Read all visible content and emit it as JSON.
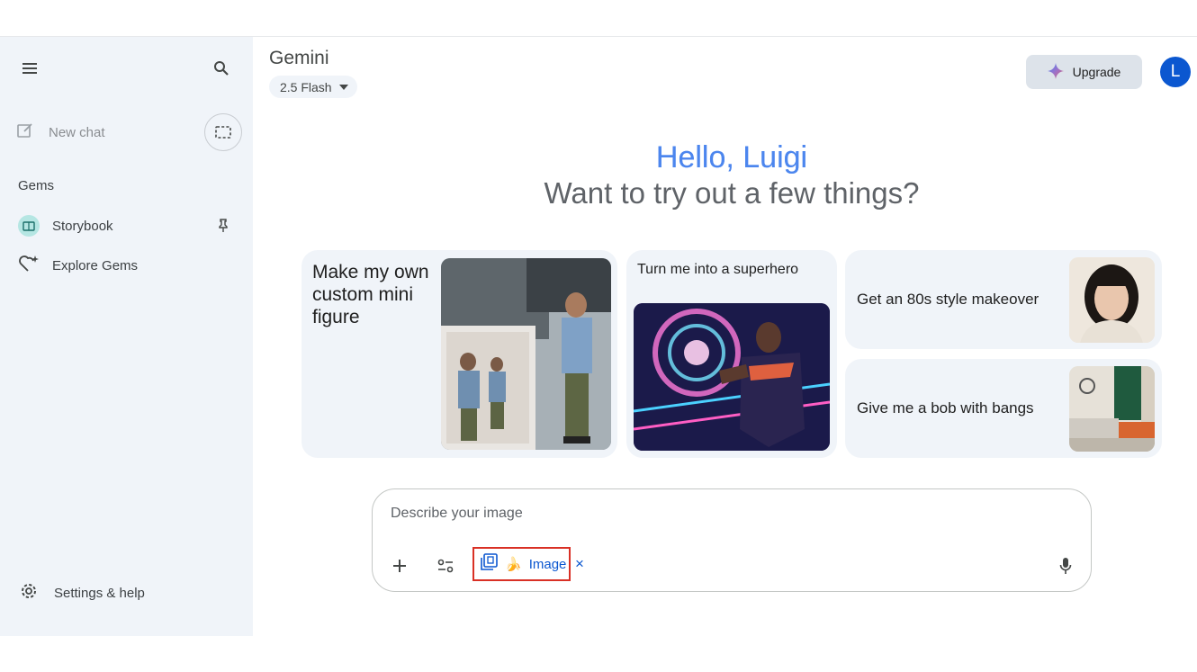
{
  "sidebar": {
    "new_chat": "New chat",
    "gems_label": "Gems",
    "items": [
      {
        "label": "Storybook",
        "icon": "book-icon"
      },
      {
        "label": "Explore Gems",
        "icon": "gem-sparkle-icon"
      }
    ],
    "settings": "Settings & help"
  },
  "header": {
    "title": "Gemini",
    "model": "2.5 Flash",
    "upgrade": "Upgrade",
    "avatar_initial": "L"
  },
  "greeting": {
    "hello": "Hello, Luigi",
    "subtitle": "Want to try out a few things?"
  },
  "cards": [
    {
      "text": "Make my own custom mini figure"
    },
    {
      "text": "Turn me into a superhero"
    },
    {
      "text": "Get an 80s style makeover"
    },
    {
      "text": "Give me a bob with bangs"
    }
  ],
  "prompt": {
    "placeholder": "Describe your image",
    "chip_label": "Image",
    "chip_emoji": "🍌",
    "close_glyph": "×"
  },
  "colors": {
    "accent": "#0b57d0",
    "sidebar_bg": "#f0f4f9",
    "highlight_box": "#d93025",
    "greeting_blue": "#4c86ee"
  }
}
